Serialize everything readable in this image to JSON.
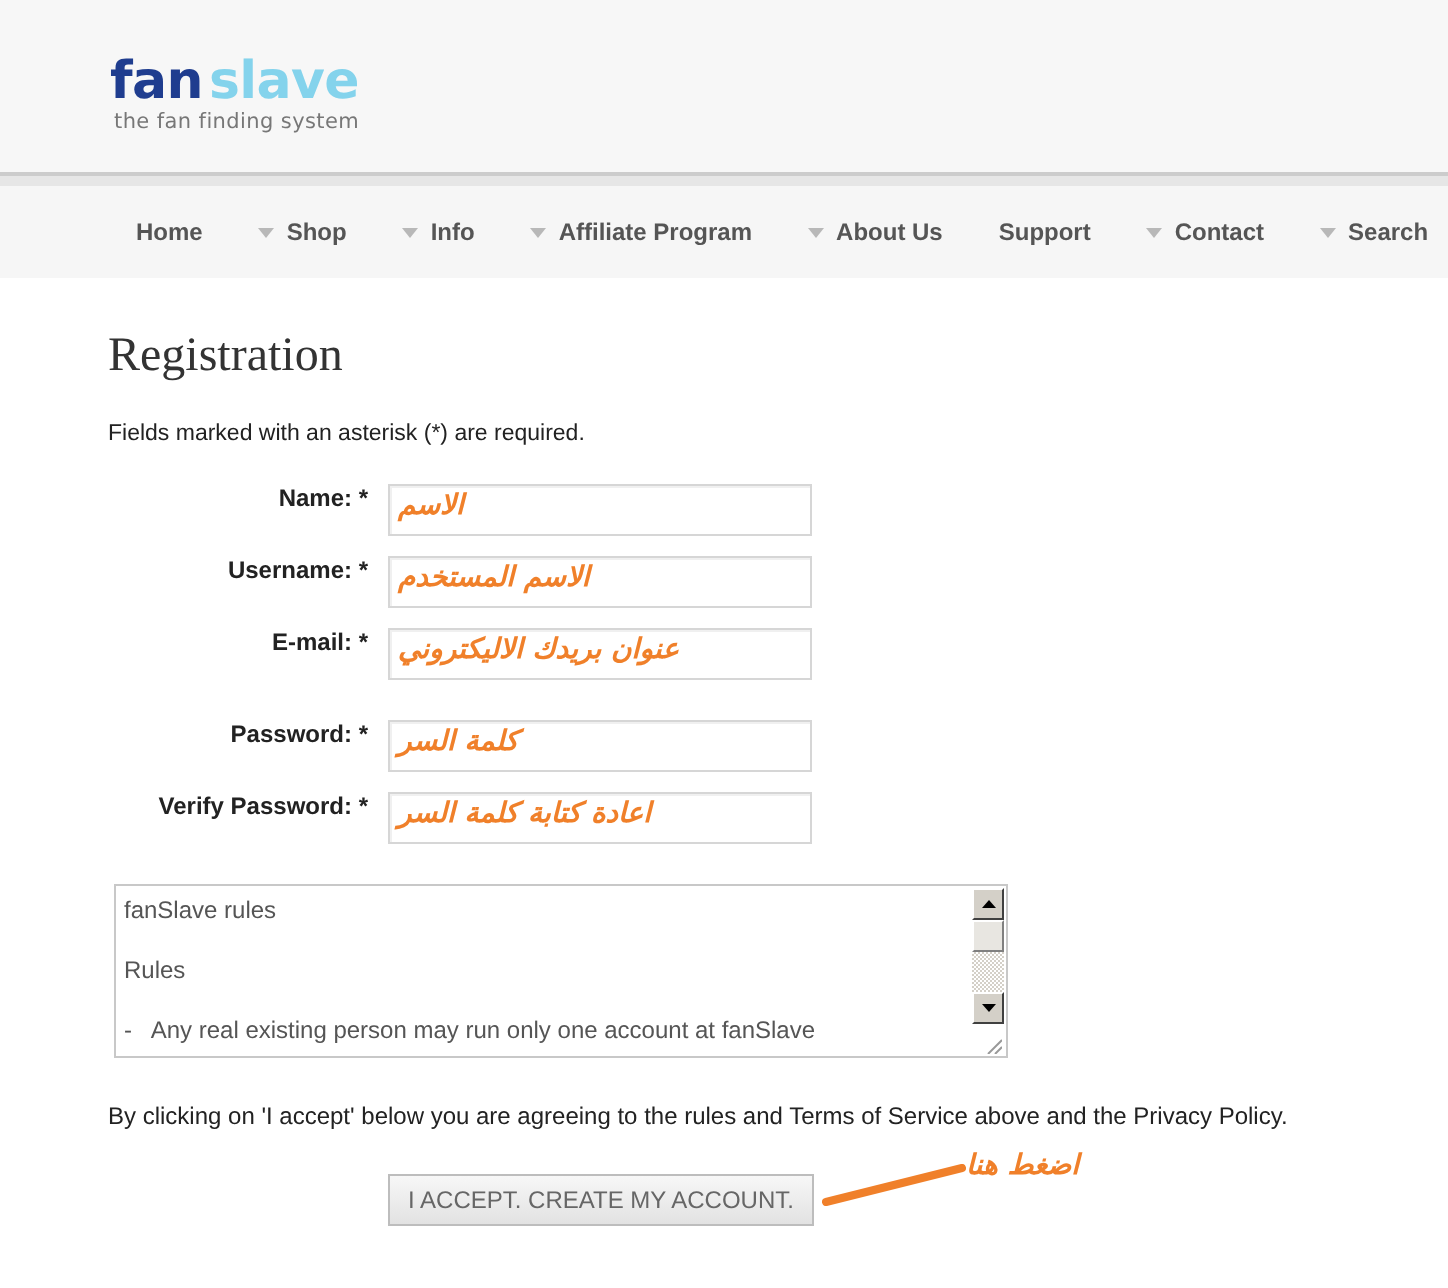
{
  "header": {
    "logo": {
      "primary": "fan",
      "secondary": "slave",
      "tagline": "the fan finding system"
    }
  },
  "nav": [
    {
      "label": "Home",
      "dropdown": false
    },
    {
      "label": "Shop",
      "dropdown": true
    },
    {
      "label": "Info",
      "dropdown": true
    },
    {
      "label": "Affiliate Program",
      "dropdown": true
    },
    {
      "label": "About Us",
      "dropdown": true
    },
    {
      "label": "Support",
      "dropdown": false
    },
    {
      "label": "Contact",
      "dropdown": true
    },
    {
      "label": "Search",
      "dropdown": true
    }
  ],
  "page": {
    "title": "Registration",
    "note": "Fields marked with an asterisk (*) are required."
  },
  "form": {
    "fields": [
      {
        "label": "Name: *",
        "annotation": "الاسم"
      },
      {
        "label": "Username: *",
        "annotation": "الاسم المستخدم"
      },
      {
        "label": "E-mail: *",
        "annotation": "عنوان بريدك الاليكتروني"
      },
      {
        "label": "Password: *",
        "annotation": "كلمة السر"
      },
      {
        "label": "Verify Password: *",
        "annotation": "اعادة كتابة كلمة السر"
      }
    ]
  },
  "rules_box": {
    "lines": [
      "fanSlave rules",
      "Rules",
      "-   Any real existing person may run only one account at fanSlave"
    ]
  },
  "terms": "By clicking on 'I accept' below you are agreeing to the rules and Terms of Service above and the Privacy Policy.",
  "submit": {
    "label": "I ACCEPT. CREATE MY ACCOUNT."
  },
  "pointer_annotation": {
    "text": "اضغط هنا"
  }
}
